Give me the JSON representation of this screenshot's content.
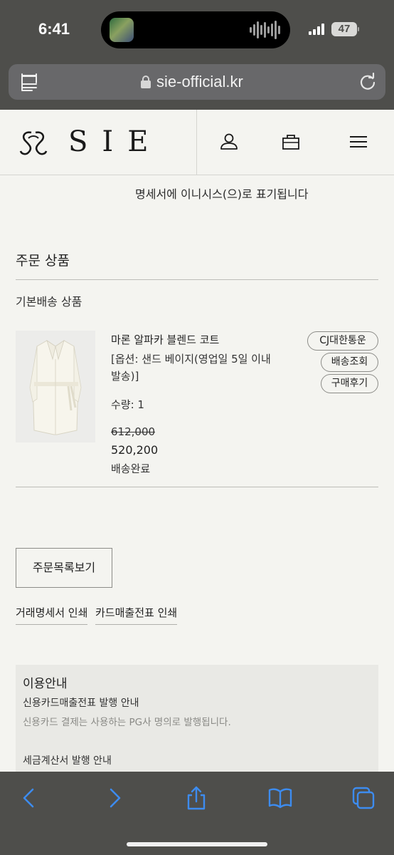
{
  "status": {
    "time": "6:41",
    "battery": "47"
  },
  "browser": {
    "url": "sie-official.kr"
  },
  "site": {
    "logo_text": "SIE"
  },
  "payment": {
    "note": "명세서에 이니시스(으)로 표기됩니다"
  },
  "order": {
    "section_title": "주문 상품",
    "delivery_group": "기본배송 상품",
    "item": {
      "name": "마론 알파카 블렌드 코트",
      "option_line1": "[옵션: 샌드 베이지(영업일 5일 이내",
      "option_line2": "발송)]",
      "quantity": "수량: 1",
      "original_price": "612,000",
      "price": "520,200",
      "status": "배송완료",
      "courier": "CJ대한통운",
      "track_label": "배송조회",
      "review_label": "구매후기"
    }
  },
  "actions": {
    "order_list": "주문목록보기",
    "print_statement": "거래명세서 인쇄",
    "print_card_receipt": "카드매출전표 인쇄"
  },
  "info": {
    "title": "이용안내",
    "card_heading": "신용카드매출전표 발행 안내",
    "card_text": "신용카드 결제는 사용하는 PG사 명의로 발행됩니다.",
    "tax_heading": "세금계산서 발행 안내"
  }
}
